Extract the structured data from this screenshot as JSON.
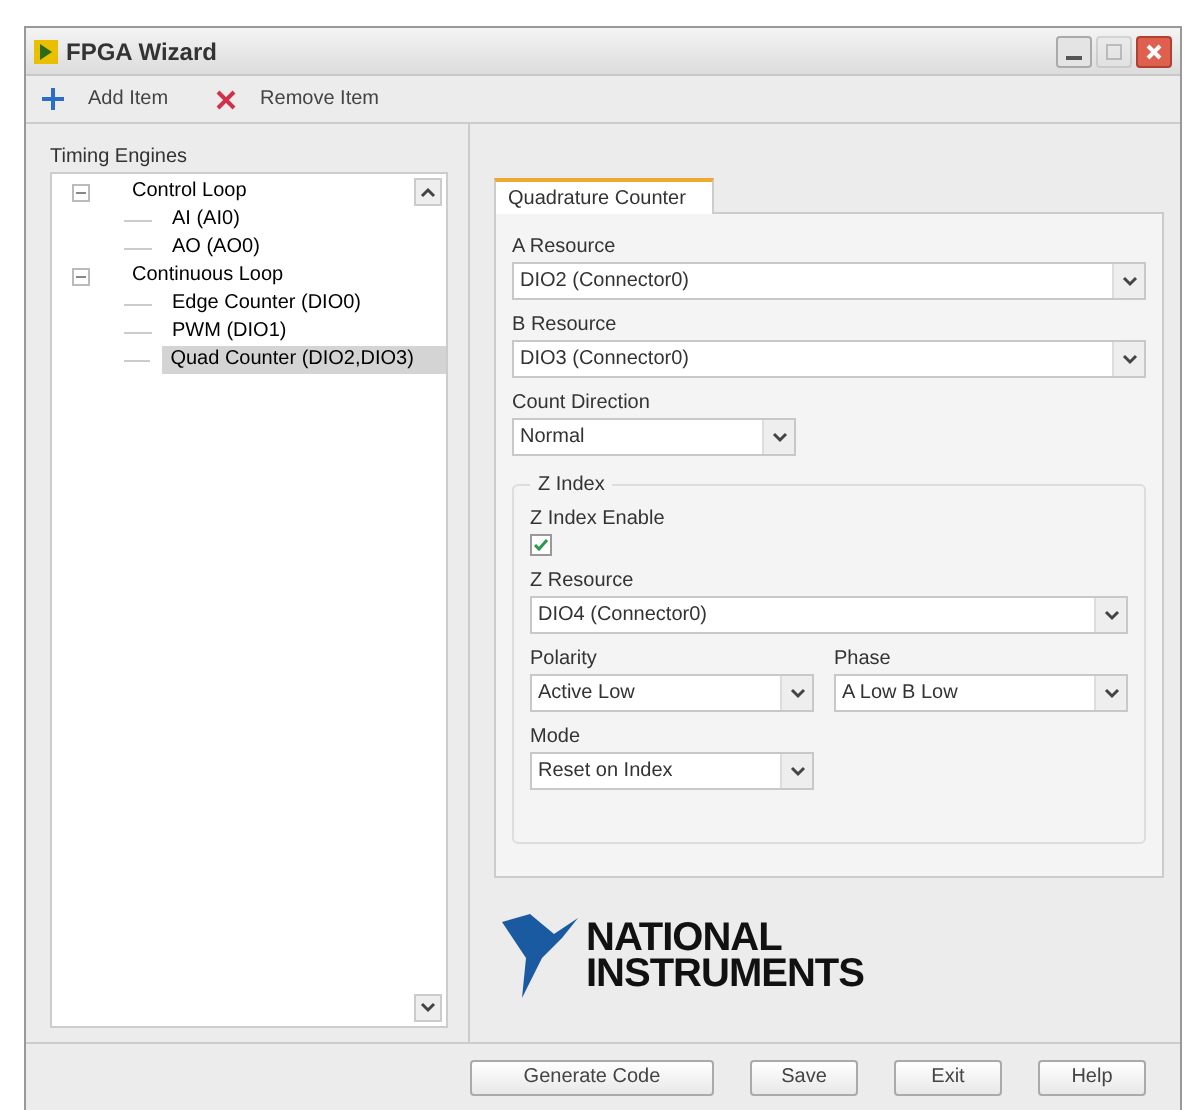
{
  "window": {
    "title": "FPGA Wizard",
    "controls": [
      {
        "kind": "minimize",
        "disabled": false
      },
      {
        "kind": "maximize",
        "disabled": true
      },
      {
        "kind": "close",
        "disabled": false
      }
    ]
  },
  "toolbar": [
    {
      "kind": "add",
      "label": "Add Item"
    },
    {
      "kind": "remove",
      "label": "Remove Item"
    }
  ],
  "tree": {
    "label": "Timing Engines",
    "items": [
      {
        "label": "Control Loop",
        "expanded": true,
        "selected": false,
        "children": [
          {
            "label": "AI (AI0)",
            "selected": false
          },
          {
            "label": "AO (AO0)",
            "selected": false
          }
        ]
      },
      {
        "label": "Continuous Loop",
        "expanded": true,
        "selected": false,
        "children": [
          {
            "label": "Edge Counter (DIO0)",
            "selected": false
          },
          {
            "label": "PWM (DIO1)",
            "selected": false
          },
          {
            "label": "Quad Counter (DIO2,DIO3)",
            "selected": true
          }
        ]
      }
    ]
  },
  "tabs": [
    {
      "label": "Quadrature Counter",
      "selected": true
    }
  ],
  "a_resource": {
    "label": "A Resource",
    "value": "DIO2 (Connector0)"
  },
  "b_resource": {
    "label": "B Resource",
    "value": "DIO3 (Connector0)"
  },
  "count_direction": {
    "label": "Count Direction",
    "value": "Normal"
  },
  "z_index": {
    "title": "Z Index",
    "enable": {
      "label": "Z Index Enable",
      "checked": true
    },
    "z_resource": {
      "label": "Z Resource",
      "value": "DIO4 (Connector0)"
    },
    "polarity": {
      "label": "Polarity",
      "value": "Active Low"
    },
    "phase": {
      "label": "Phase",
      "value": "A Low B Low"
    },
    "mode": {
      "label": "Mode",
      "value": "Reset on Index"
    }
  },
  "logo": {
    "line1": "NATIONAL",
    "line2": "INSTRUMENTS"
  },
  "buttons": [
    "Generate Code",
    "Save",
    "Exit",
    "Help"
  ]
}
